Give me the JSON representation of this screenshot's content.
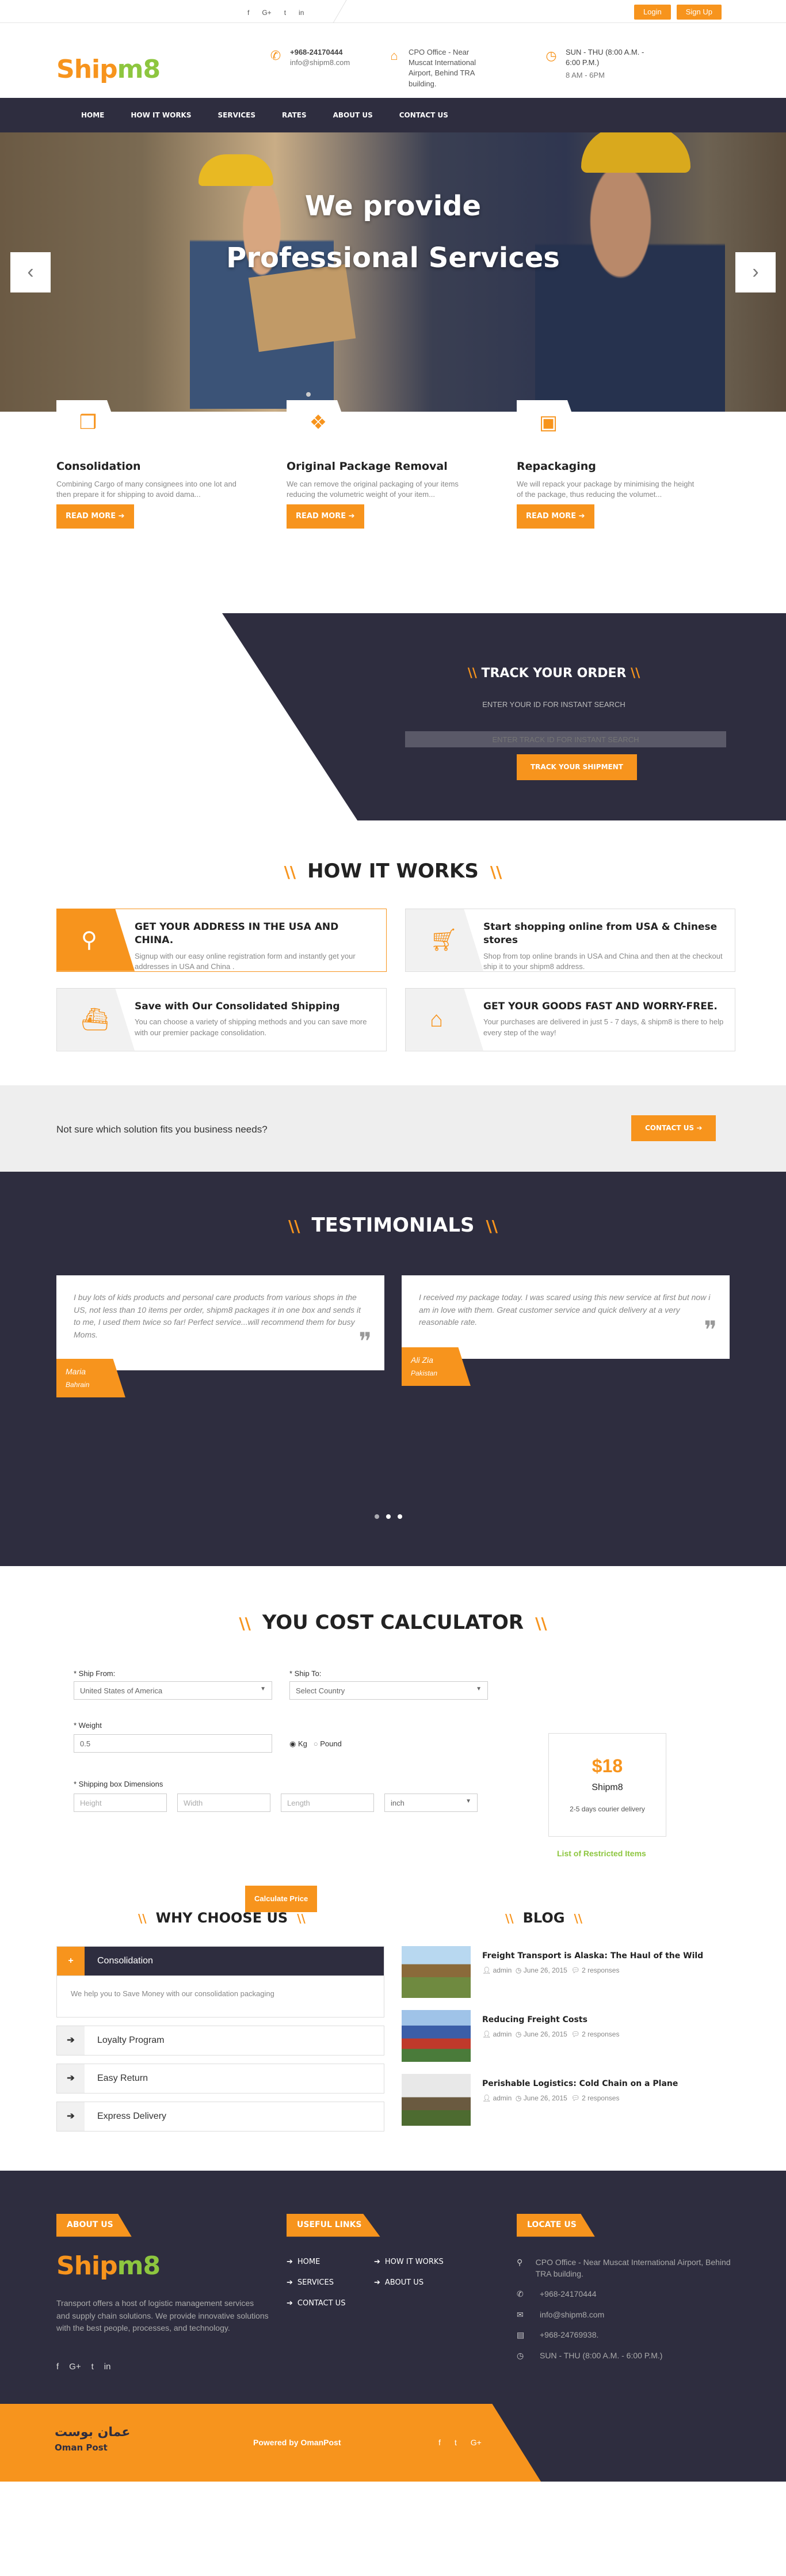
{
  "topbar": {
    "social": [
      "f",
      "G+",
      "t",
      "in"
    ],
    "login": "Login",
    "signup": "Sign Up"
  },
  "header": {
    "logo_a": "Ship",
    "logo_b": "m8",
    "phone": "+968-24170444",
    "email": "info@shipm8.com",
    "office": "CPO Office - Near Muscat International Airport, Behind TRA building.",
    "hours": "SUN - THU (8:00 A.M. - 6:00 P.M.)",
    "hours2": "8 AM - 6PM"
  },
  "nav": [
    "HOME",
    "HOW IT WORKS",
    "SERVICES",
    "RATES",
    "ABOUT US",
    "CONTACT US"
  ],
  "hero": {
    "line1": "We provide",
    "line2": "Professional Services",
    "prev": "‹",
    "next": "›"
  },
  "services": [
    {
      "title": "Consolidation",
      "text": "Combining Cargo of many consignees into one lot and then prepare it for shipping to avoid dama...",
      "btn": "READ MORE ➔"
    },
    {
      "title": "Original Package Removal",
      "text": "We can remove the original packaging of your items reducing the volumetric weight of your item...",
      "btn": "READ MORE ➔"
    },
    {
      "title": "Repackaging",
      "text": "We will repack your package by minimising the height of the package, thus reducing the volumet...",
      "btn": "READ MORE ➔"
    }
  ],
  "track": {
    "title": "TRACK YOUR ORDER",
    "sub": "ENTER YOUR ID FOR INSTANT SEARCH",
    "placeholder": "ENTER TRACK ID FOR INSTANT SEARCH",
    "btn": "TRACK YOUR SHIPMENT"
  },
  "how": {
    "title": "HOW IT WORKS",
    "items": [
      {
        "title": "GET YOUR ADDRESS IN THE USA AND CHINA.",
        "text": "Signup with our easy online registration form and instantly get your addresses in USA and China ."
      },
      {
        "title": "Start shopping online from USA & Chinese stores",
        "text": "Shop from top online brands in USA and China and then at the checkout ship it to your shipm8 address."
      },
      {
        "title": "Save with Our Consolidated Shipping",
        "text": "You can choose a variety of shipping methods and you can save more with our premier package consolidation."
      },
      {
        "title": "GET YOUR GOODS FAST AND WORRY-FREE.",
        "text": "Your purchases are delivered in just 5 - 7 days, & shipm8 is there to help every step of the way!"
      }
    ]
  },
  "cta": {
    "text": "Not sure which solution fits you business needs?",
    "btn": "CONTACT US ➔"
  },
  "testimonials": {
    "title": "TESTIMONIALS",
    "items": [
      {
        "text": "I buy lots of kids products and personal care products from various shops in the US, not less than 10 items per order, shipm8 packages it in one box and sends it to me, I used them twice so far! Perfect service...will recommend them for busy Moms.",
        "name": "Maria",
        "place": "Bahrain"
      },
      {
        "text": "I received my package today. I was scared using this new service at first but now i am in love with them. Great customer service and quick delivery at a very reasonable rate.",
        "name": "Ali Zia",
        "place": "Pakistan"
      }
    ]
  },
  "calc": {
    "title": "YOU COST CALCULATOR",
    "from_label": "* Ship From:",
    "from_value": "United States of America",
    "to_label": "* Ship To:",
    "to_value": "Select Country",
    "weight_label": "* Weight",
    "weight_value": "0.5",
    "kg": "Kg",
    "pound": "Pound",
    "dim_label": "* Shipping box Dimensions",
    "h": "Height",
    "w": "Width",
    "l": "Length",
    "unit": "inch",
    "btn": "Calculate Price",
    "price": "$18",
    "company": "Shipm8",
    "delivery": "2-5 days courier delivery",
    "restricted": "List of Restricted Items"
  },
  "why": {
    "title": "WHY CHOOSE US",
    "items": [
      "Consolidation",
      "Loyalty Program",
      "Easy Return",
      "Express Delivery"
    ],
    "open_text": "We help you to Save Money with our consolidation packaging"
  },
  "blog": {
    "title": "BLOG",
    "posts": [
      {
        "title": "Freight Transport is Alaska: The Haul of the Wild",
        "author": "admin",
        "date": "June 26, 2015",
        "resp": "2 responses"
      },
      {
        "title": "Reducing Freight Costs",
        "author": "admin",
        "date": "June 26, 2015",
        "resp": "2 responses"
      },
      {
        "title": "Perishable Logistics: Cold Chain on a Plane",
        "author": "admin",
        "date": "June 26, 2015",
        "resp": "2 responses"
      }
    ]
  },
  "footer": {
    "about_tag": "ABOUT US",
    "links_tag": "USEFUL LINKS",
    "locate_tag": "LOCATE US",
    "about": "Transport offers a host of logistic management services and supply chain solutions. We provide innovative solutions with the best people, processes, and technology.",
    "links_a": [
      "HOME",
      "SERVICES",
      "CONTACT US"
    ],
    "links_b": [
      "HOW IT WORKS",
      "ABOUT US"
    ],
    "address": "CPO Office - Near Muscat International Airport, Behind TRA building.",
    "phone": "+968-24170444",
    "email": "info@shipm8.com",
    "fax": "+968-24769938.",
    "hours": "SUN - THU (8:00 A.M. - 6:00 P.M.)"
  },
  "bottom": {
    "brand": "عمان بوست",
    "brand_en": "Oman Post",
    "powered": "Powered by OmanPost"
  }
}
